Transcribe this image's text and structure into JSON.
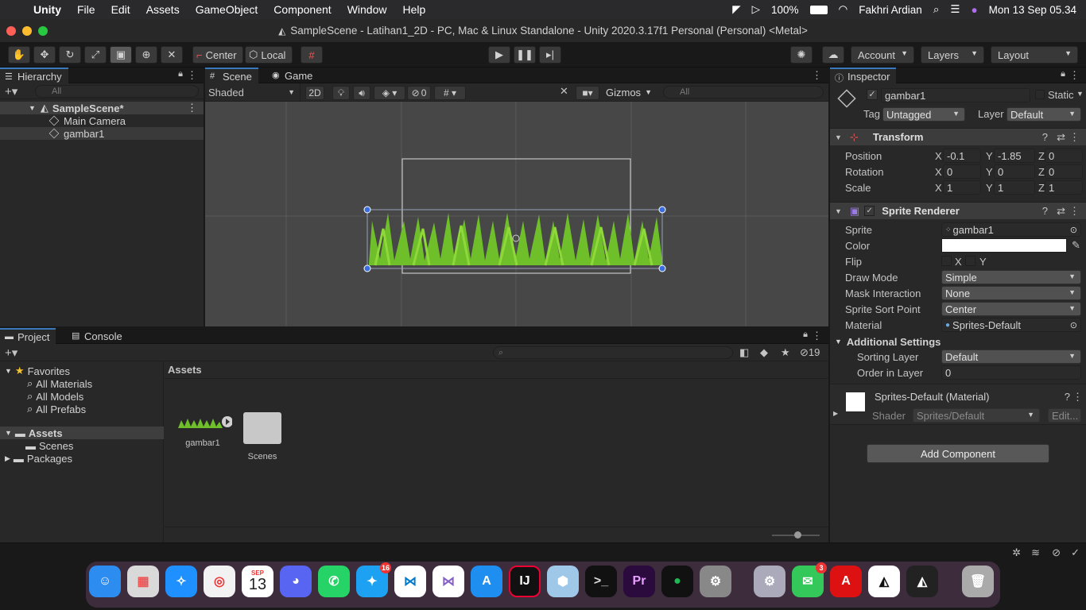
{
  "menubar": {
    "app": "Unity",
    "items": [
      "File",
      "Edit",
      "Assets",
      "GameObject",
      "Component",
      "Window",
      "Help"
    ],
    "battery": "100%",
    "user": "Fakhri Ardian",
    "datetime": "Mon 13 Sep  05.34"
  },
  "window": {
    "title": "SampleScene - Latihan1_2D - PC, Mac & Linux Standalone - Unity 2020.3.17f1 Personal (Personal) <Metal>"
  },
  "toolbar": {
    "pivot": "Center",
    "space": "Local",
    "account": "Account",
    "layers": "Layers",
    "layout": "Layout"
  },
  "hierarchy": {
    "tab": "Hierarchy",
    "search_placeholder": "All",
    "scene": "SampleScene*",
    "objects": [
      "Main Camera",
      "gambar1"
    ]
  },
  "scene_view": {
    "tabs": [
      "Scene",
      "Game"
    ],
    "shading": "Shaded",
    "mode_2d": "2D",
    "hidden_count": "0",
    "gizmos": "Gizmos",
    "search_placeholder": "All"
  },
  "project": {
    "tabs": [
      "Project",
      "Console"
    ],
    "hidden_count": "19",
    "favorites_label": "Favorites",
    "favorites": [
      "All Materials",
      "All Models",
      "All Prefabs"
    ],
    "assets_label": "Assets",
    "asset_folders": [
      "Scenes"
    ],
    "packages_label": "Packages",
    "breadcrumb": "Assets",
    "items": [
      "gambar1",
      "Scenes"
    ]
  },
  "inspector": {
    "tab": "Inspector",
    "object_name": "gambar1",
    "static_label": "Static",
    "tag_label": "Tag",
    "tag_value": "Untagged",
    "layer_label": "Layer",
    "layer_value": "Default",
    "transform": {
      "title": "Transform",
      "position_label": "Position",
      "rotation_label": "Rotation",
      "scale_label": "Scale",
      "position": {
        "x": "-0.1",
        "y": "-1.85",
        "z": "0"
      },
      "rotation": {
        "x": "0",
        "y": "0",
        "z": "0"
      },
      "scale": {
        "x": "1",
        "y": "1",
        "z": "1"
      }
    },
    "sprite_renderer": {
      "title": "Sprite Renderer",
      "sprite_label": "Sprite",
      "sprite_value": "gambar1",
      "color_label": "Color",
      "flip_label": "Flip",
      "flip_x": "X",
      "flip_y": "Y",
      "draw_mode_label": "Draw Mode",
      "draw_mode_value": "Simple",
      "mask_label": "Mask Interaction",
      "mask_value": "None",
      "sort_point_label": "Sprite Sort Point",
      "sort_point_value": "Center",
      "material_label": "Material",
      "material_value": "Sprites-Default",
      "additional_label": "Additional Settings",
      "sorting_layer_label": "Sorting Layer",
      "sorting_layer_value": "Default",
      "order_label": "Order in Layer",
      "order_value": "0"
    },
    "material": {
      "name": "Sprites-Default (Material)",
      "shader_label": "Shader",
      "shader_value": "Sprites/Default",
      "edit_label": "Edit..."
    },
    "add_component": "Add Component"
  },
  "dock": {
    "calendar_month": "SEP",
    "calendar_day": "13",
    "twitter_badge": "16",
    "messages_badge": "3"
  },
  "colors": {
    "accent": "#3a79bb",
    "panel": "#282828",
    "grass": "#6fbf2a"
  }
}
